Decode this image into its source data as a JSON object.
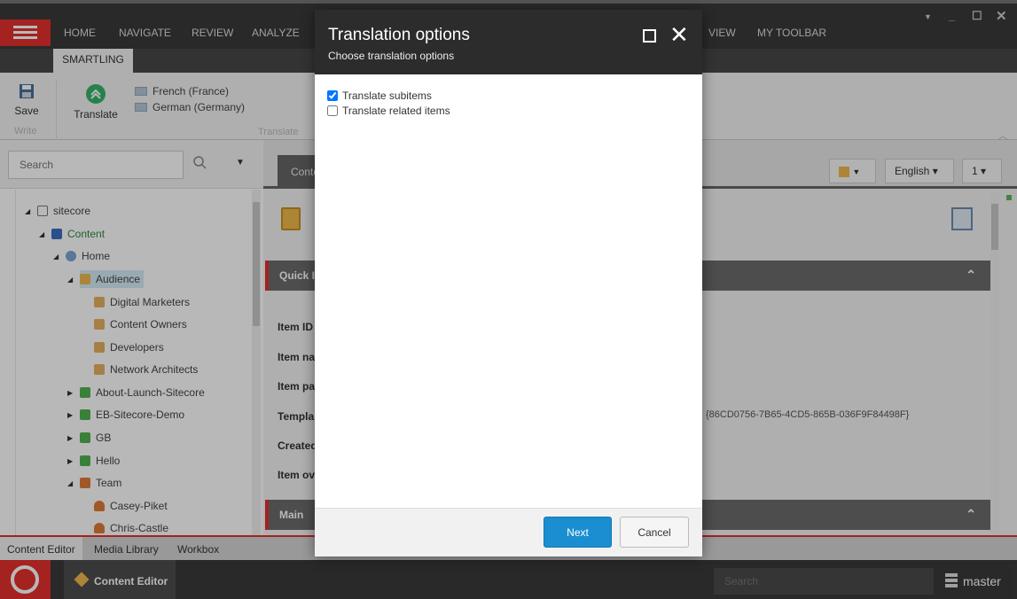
{
  "topbar": {
    "menu_tabs": [
      "HOME",
      "NAVIGATE",
      "REVIEW",
      "ANALYZE",
      "VIEW",
      "MY TOOLBAR"
    ],
    "active_tab": "SMARTLING"
  },
  "ribbon": {
    "save_label": "Save",
    "write_group": "Write",
    "translate_label": "Translate",
    "translate_group": "Translate",
    "languages": [
      "French (France)",
      "German (Germany)"
    ]
  },
  "left_panel": {
    "search_placeholder": "Search",
    "tree": [
      {
        "label": "sitecore"
      },
      {
        "label": "Content"
      },
      {
        "label": "Home"
      },
      {
        "label": "Audience"
      },
      {
        "label": "Digital Marketers"
      },
      {
        "label": "Content Owners"
      },
      {
        "label": "Developers"
      },
      {
        "label": "Network Architects"
      },
      {
        "label": "About-Launch-Sitecore"
      },
      {
        "label": "EB-Sitecore-Demo"
      },
      {
        "label": "GB"
      },
      {
        "label": "Hello"
      },
      {
        "label": "Team"
      },
      {
        "label": "Casey-Piket"
      },
      {
        "label": "Chris-Castle"
      }
    ]
  },
  "right_panel": {
    "content_tab": "Conte",
    "language_button": "English ▾",
    "version_button": "1 ▾",
    "quick_info": "Quick In",
    "fields": [
      "Item ID",
      "Item na",
      "Item pa",
      "Templa",
      "Created",
      "Item ov"
    ],
    "template_id": "{86CD0756-7B65-4CD5-865B-036F9F84498F}",
    "main_section": "Main"
  },
  "bottom_tabs": [
    "Content Editor",
    "Media Library",
    "Workbox"
  ],
  "taskbar": {
    "active_app": "Content Editor",
    "search_placeholder": "Search",
    "database": "master"
  },
  "modal": {
    "title": "Translation options",
    "subtitle": "Choose translation options",
    "options": [
      {
        "label": "Translate subitems",
        "checked": true
      },
      {
        "label": "Translate related items",
        "checked": false
      }
    ],
    "next_label": "Next",
    "cancel_label": "Cancel"
  }
}
